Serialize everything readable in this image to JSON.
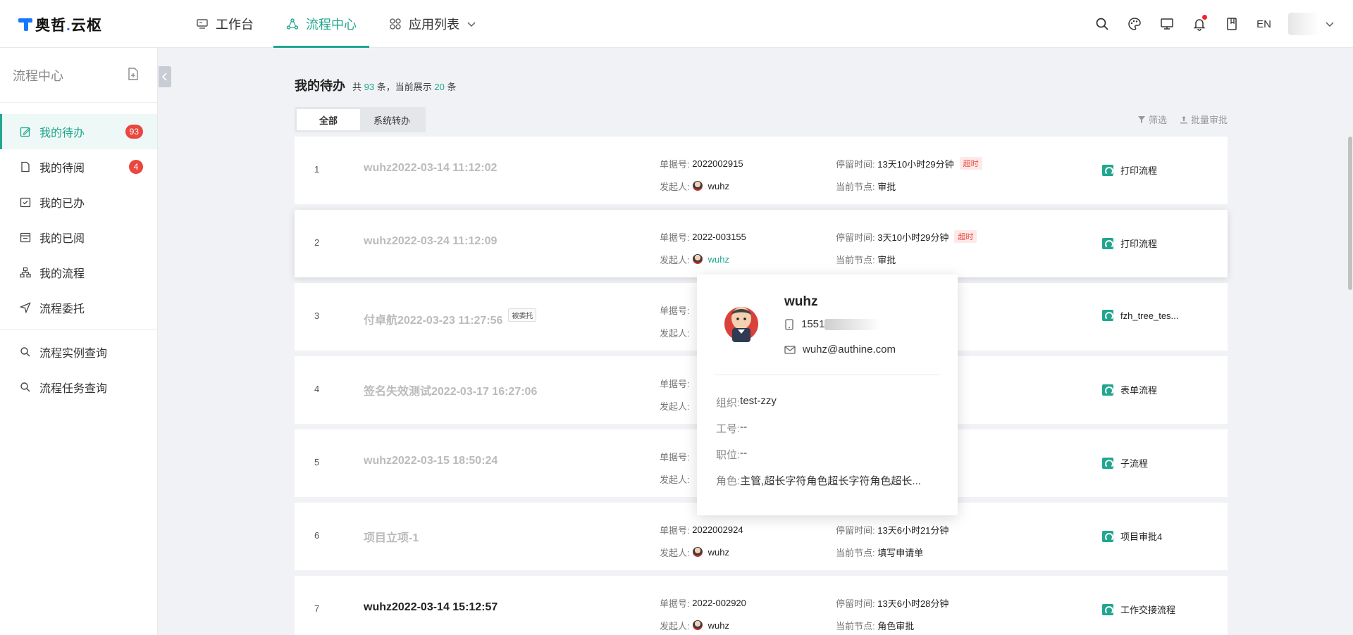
{
  "app": {
    "logo_text": "奥哲",
    "logo_dot": ".",
    "logo_text2": "云枢"
  },
  "nav": {
    "items": [
      {
        "label": "工作台",
        "icon": "monitor-icon"
      },
      {
        "label": "流程中心",
        "icon": "flow-icon",
        "active": true
      },
      {
        "label": "应用列表",
        "icon": "apps-icon"
      }
    ]
  },
  "topbar": {
    "lang": "EN"
  },
  "sidebar": {
    "title": "流程中心",
    "items": [
      {
        "label": "我的待办",
        "badge": "93",
        "active": true
      },
      {
        "label": "我的待阅",
        "badge": "4"
      },
      {
        "label": "我的已办"
      },
      {
        "label": "我的已阅"
      },
      {
        "label": "我的流程"
      },
      {
        "label": "流程委托"
      }
    ],
    "queries": [
      {
        "label": "流程实例查询"
      },
      {
        "label": "流程任务查询"
      }
    ]
  },
  "main": {
    "title": "我的待办",
    "count_pre": "共",
    "total": "93",
    "count_mid": "条，当前展示",
    "shown": "20",
    "count_post": "条",
    "tabs": [
      "全部",
      "系统转办"
    ],
    "filter_label": "筛选",
    "batch_label": "批量审批"
  },
  "labels": {
    "order_no": "单据号:",
    "initiator": "发起人:",
    "stay_time": "停留时间:",
    "current_node": "当前节点:",
    "overtime": "超时"
  },
  "rows": [
    {
      "idx": "1",
      "title": "wuhz2022-03-14 11:12:02",
      "order_no": "2022002915",
      "initiator": "wuhz",
      "stay_time": "13天10小时29分钟",
      "overtime": true,
      "node": "审批",
      "flow": "打印流程"
    },
    {
      "idx": "2",
      "title": "wuhz2022-03-24 11:12:09",
      "order_no": "2022-003155",
      "initiator": "wuhz",
      "stay_time": "3天10小时29分钟",
      "overtime": true,
      "node": "审批",
      "flow": "打印流程"
    },
    {
      "idx": "3",
      "title": "付卓航2022-03-23 11:27:56",
      "tag": "被委托",
      "order_no": "",
      "initiator": "",
      "stay_time": "",
      "node": "",
      "flow": "fzh_tree_tes..."
    },
    {
      "idx": "4",
      "title": "签名失效测试2022-03-17 16:27:06",
      "order_no": "",
      "initiator": "",
      "stay_time": "",
      "node": "",
      "flow": "表单流程"
    },
    {
      "idx": "5",
      "title": "wuhz2022-03-15 18:50:24",
      "order_no": "",
      "initiator": "",
      "stay_time": "",
      "node": "",
      "flow": "子流程"
    },
    {
      "idx": "6",
      "title": "项目立项-1",
      "order_no": "2022002924",
      "initiator": "wuhz",
      "stay_time": "13天6小时21分钟",
      "node": "填写申请单",
      "flow": "项目审批4"
    },
    {
      "idx": "7",
      "title": "wuhz2022-03-14 15:12:57",
      "order_no": "2022-002920",
      "initiator": "wuhz",
      "stay_time": "13天6小时28分钟",
      "node": "角色审批",
      "flow": "工作交接流程"
    }
  ],
  "popover": {
    "name": "wuhz",
    "phone": "1551",
    "email": "wuhz@authine.com",
    "org_label": "组织:",
    "org": "test-zzy",
    "job_no_label": "工号:",
    "job_no": "--",
    "position_label": "职位:",
    "position": "--",
    "role_label": "角色:",
    "role": "主管,超长字符角色超长字符角色超长..."
  }
}
